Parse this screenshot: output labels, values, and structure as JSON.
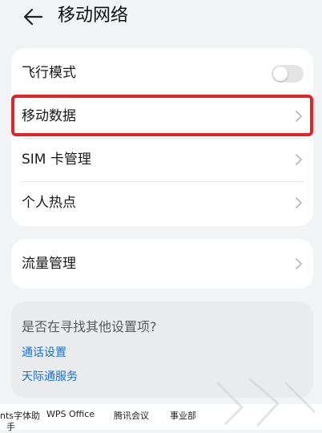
{
  "header": {
    "title": "移动网络",
    "back_icon": "back-arrow-icon"
  },
  "card1": {
    "rows": [
      {
        "label": "飞行模式",
        "control": "toggle",
        "toggle_on": false
      },
      {
        "label": "移动数据",
        "control": "chevron"
      },
      {
        "label": "SIM 卡管理",
        "control": "chevron"
      },
      {
        "label": "个人热点",
        "control": "chevron"
      }
    ]
  },
  "card2": {
    "rows": [
      {
        "label": "流量管理",
        "control": "chevron"
      }
    ]
  },
  "suggest": {
    "question": "是否在寻找其他设置项?",
    "links": [
      "通话设置",
      "天际通服务"
    ]
  },
  "taskbar": {
    "items": [
      "nts字体助",
      "WPS Office",
      "腾讯会议",
      "事业部",
      "手"
    ]
  },
  "colors": {
    "highlight": "#e0242b",
    "link": "#1f6fc8",
    "background": "#f1f3f5"
  }
}
